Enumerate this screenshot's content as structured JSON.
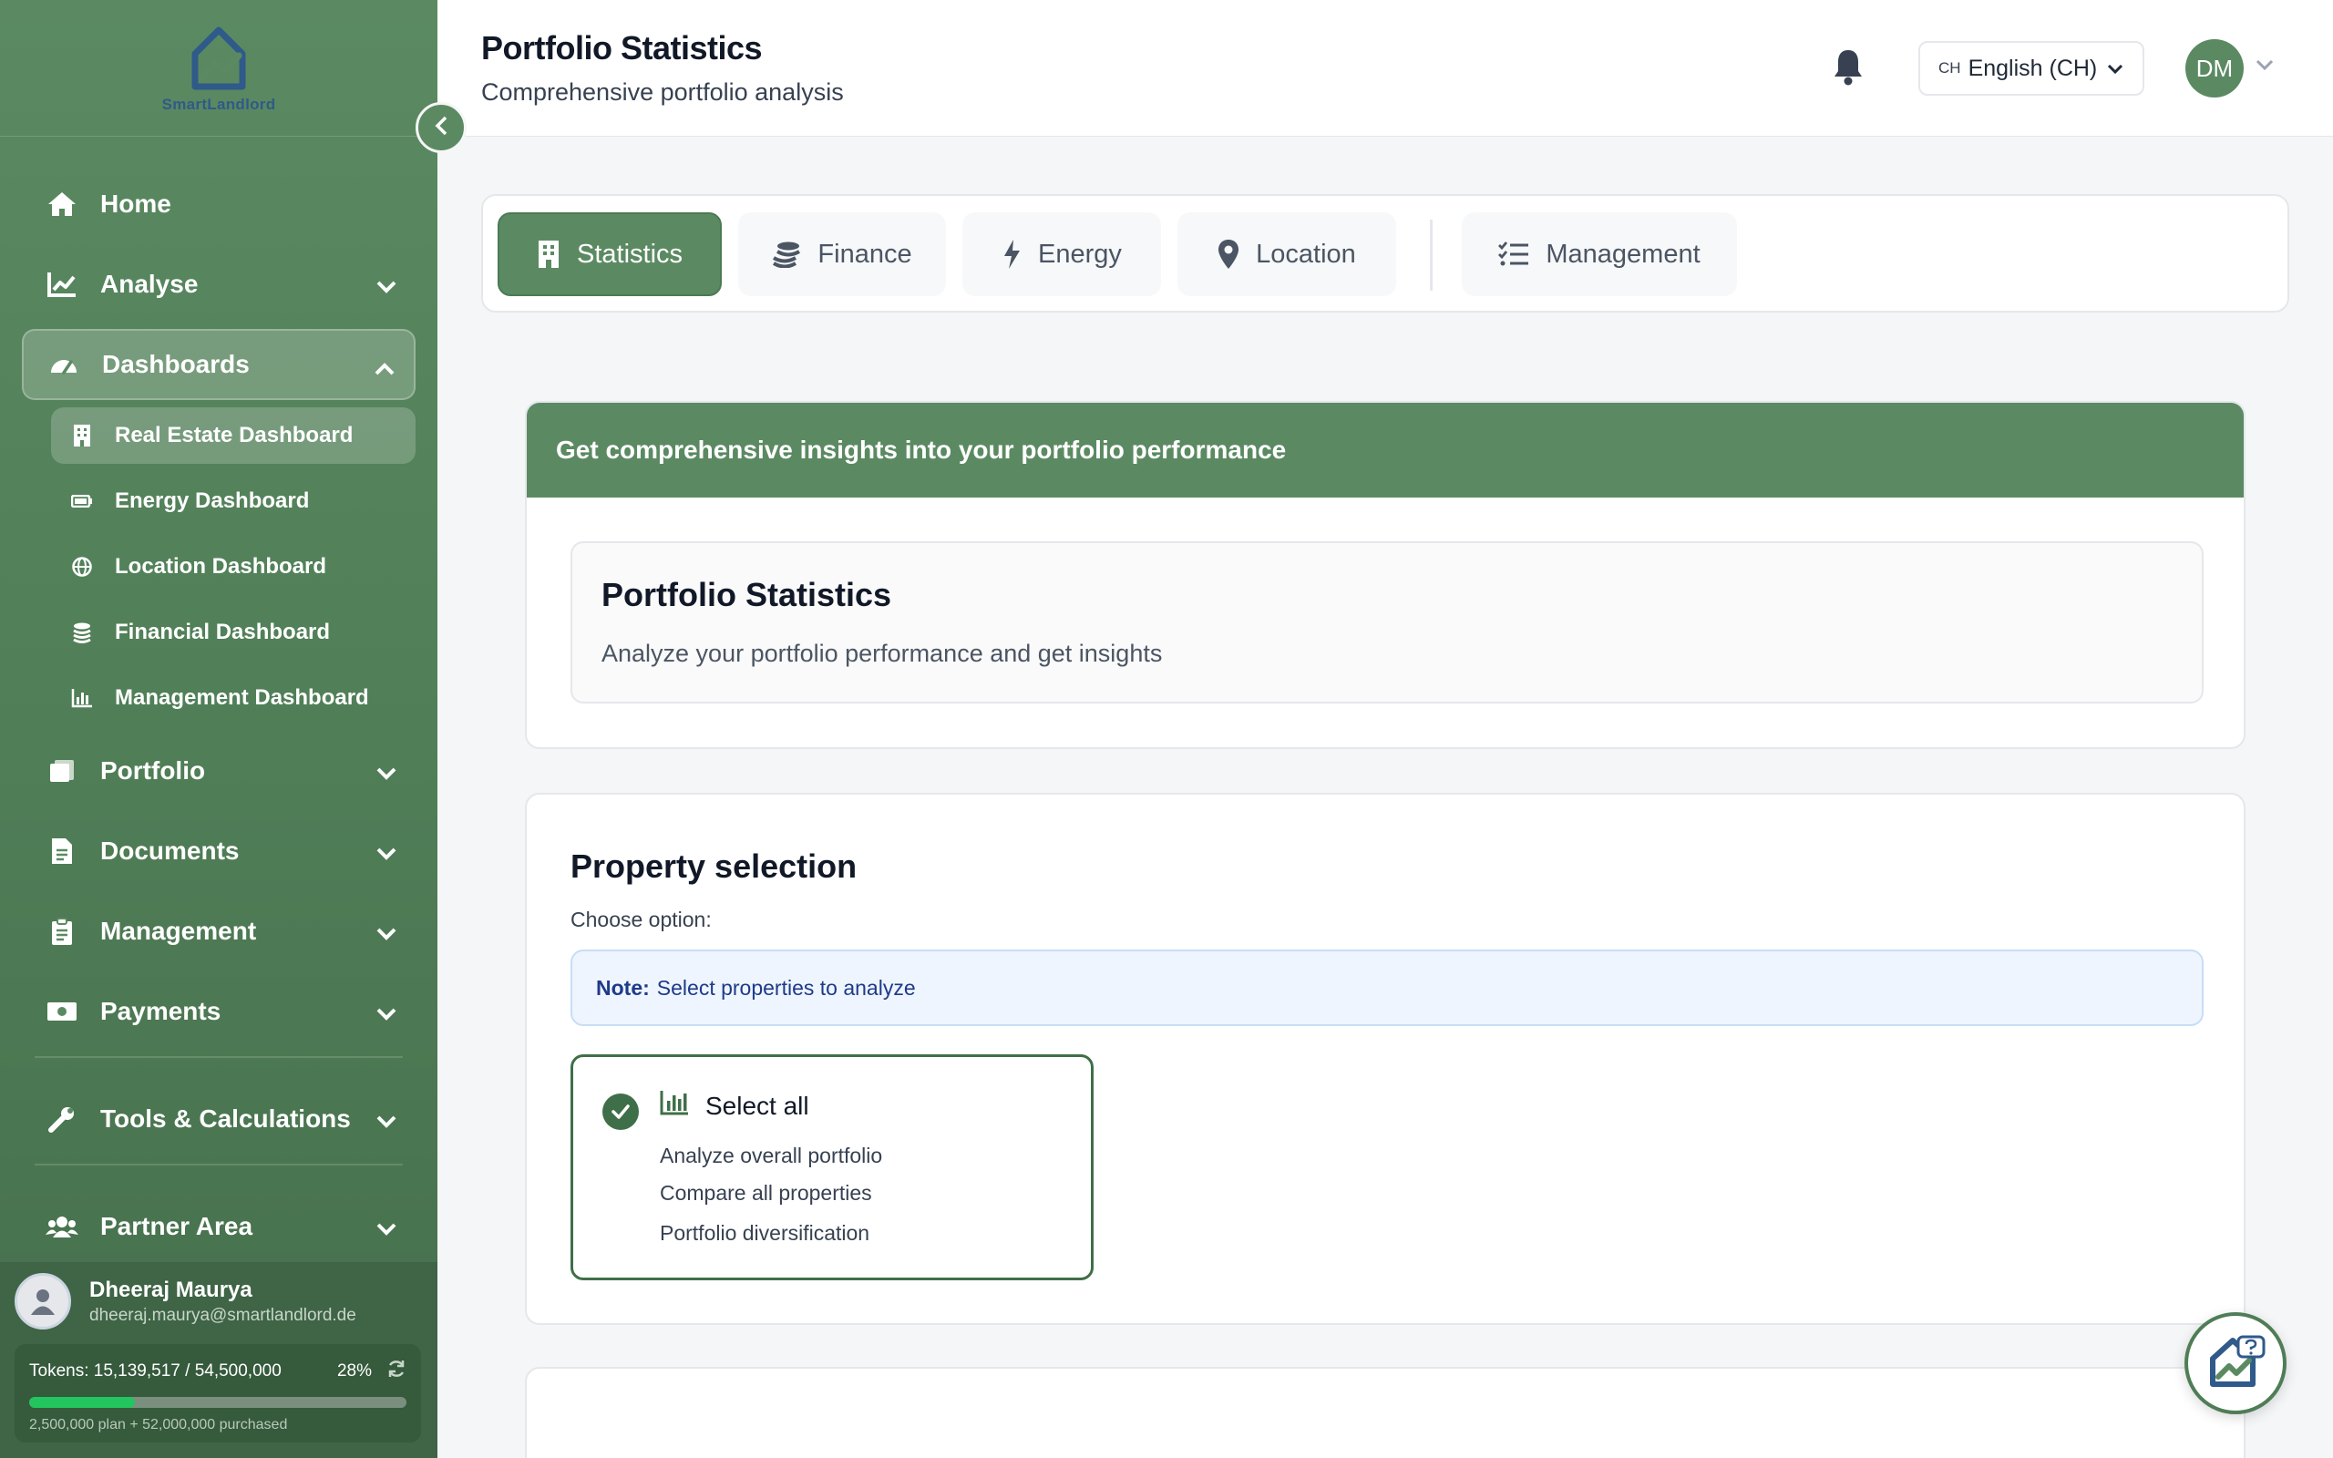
{
  "sidebar": {
    "logo_text": "SmartLandlord",
    "items": [
      {
        "label": "Home"
      },
      {
        "label": "Analyse"
      },
      {
        "label": "Dashboards"
      },
      {
        "label": "Portfolio"
      },
      {
        "label": "Documents"
      },
      {
        "label": "Management"
      },
      {
        "label": "Payments"
      },
      {
        "label": "Tools & Calculations"
      },
      {
        "label": "Partner Area"
      }
    ],
    "dashboard_subitems": [
      {
        "label": "Real Estate Dashboard"
      },
      {
        "label": "Energy Dashboard"
      },
      {
        "label": "Location Dashboard"
      },
      {
        "label": "Financial Dashboard"
      },
      {
        "label": "Management Dashboard"
      }
    ],
    "user": {
      "name": "Dheeraj Maurya",
      "email": "dheeraj.maurya@smartlandlord.de"
    },
    "tokens": {
      "label": "Tokens: 15,139,517 / 54,500,000",
      "percent_label": "28%",
      "used_fraction": 0.28,
      "footnote": "2,500,000 plan + 52,000,000 purchased"
    }
  },
  "header": {
    "title": "Portfolio Statistics",
    "subtitle": "Comprehensive portfolio analysis",
    "language_code": "CH",
    "language_label": "English (CH)",
    "avatar_initials": "DM"
  },
  "tabs": [
    {
      "label": "Statistics",
      "active": true
    },
    {
      "label": "Finance"
    },
    {
      "label": "Energy"
    },
    {
      "label": "Location"
    },
    {
      "label": "Management"
    }
  ],
  "insight": {
    "banner": "Get comprehensive insights into your portfolio performance",
    "card_title": "Portfolio Statistics",
    "card_subtitle": "Analyze your portfolio performance and get insights"
  },
  "selection": {
    "title": "Property selection",
    "choose_label": "Choose option:",
    "note_label": "Note:",
    "note_text": "Select properties to analyze",
    "option": {
      "title": "Select all",
      "lines": [
        "Analyze overall portfolio",
        "Compare all properties",
        "Portfolio diversification"
      ],
      "checked": true
    }
  },
  "colors": {
    "brand_green": "#5b8a62",
    "dark_green": "#3f6f48",
    "token_fill": "#22c55e",
    "note_bg": "#eef5fe"
  }
}
